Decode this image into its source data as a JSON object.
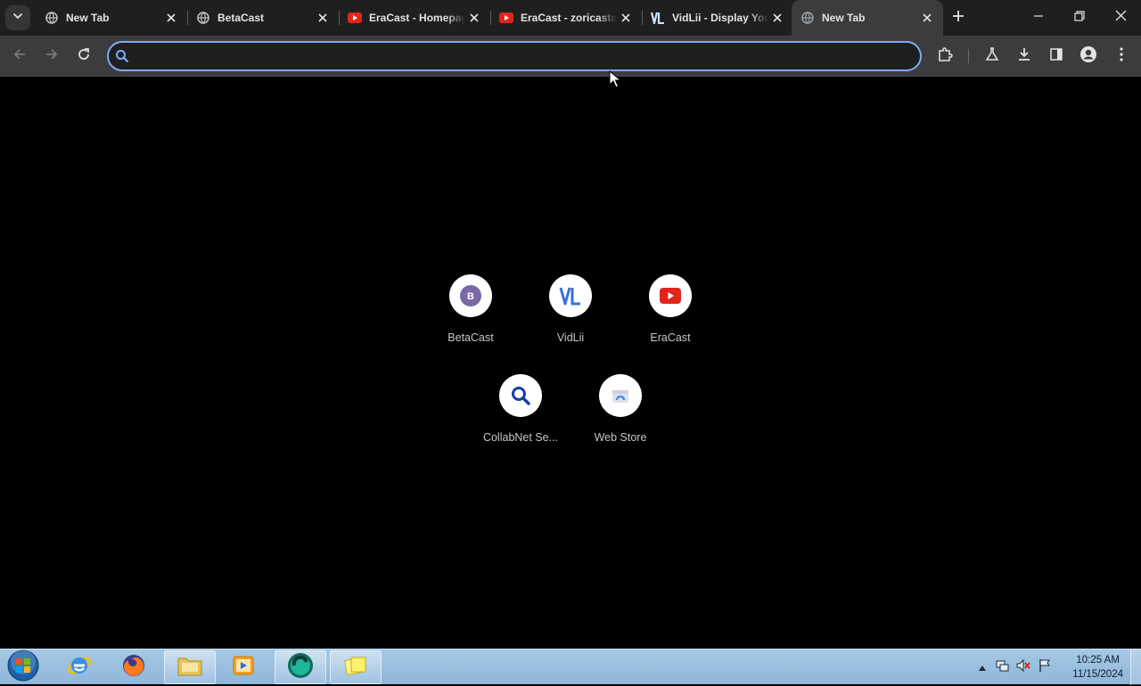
{
  "browser": {
    "tabs": [
      {
        "title": "New Tab",
        "favicon": "globe-icon",
        "active": false
      },
      {
        "title": "BetaCast",
        "favicon": "globe-icon",
        "active": false
      },
      {
        "title": "EraCast - Homepage",
        "favicon": "youtube-icon",
        "active": false
      },
      {
        "title": "EraCast - zoricastas",
        "favicon": "youtube-icon",
        "active": false
      },
      {
        "title": "VidLii - Display Yourself",
        "favicon": "vidlii-icon",
        "active": false
      },
      {
        "title": "New Tab",
        "favicon": "globe-icon",
        "active": true
      }
    ],
    "omnibox": {
      "value": "",
      "placeholder": ""
    }
  },
  "ntp": {
    "shortcuts": [
      {
        "label": "BetaCast",
        "icon": "betacast-icon",
        "letter": "B"
      },
      {
        "label": "VidLii",
        "icon": "vidlii-icon",
        "letter": "VL"
      },
      {
        "label": "EraCast",
        "icon": "youtube-icon"
      },
      {
        "label": "CollabNet Se...",
        "icon": "search-icon"
      },
      {
        "label": "Web Store",
        "icon": "web-store-icon"
      }
    ]
  },
  "taskbar": {
    "apps": [
      "internet-explorer-icon",
      "firefox-icon",
      "file-explorer-icon",
      "media-player-icon",
      "browser-icon",
      "sticky-notes-icon"
    ],
    "clock": {
      "time": "10:25 AM",
      "date": "11/15/2024"
    }
  },
  "colors": {
    "accent": "#7cacf8",
    "tabstrip": "#1f1f1f",
    "toolbar": "#3c3c3c",
    "youtube_red": "#e1251b",
    "betacast_purple": "#7b68a6",
    "vidlii_blue": "#3b6fd8"
  }
}
